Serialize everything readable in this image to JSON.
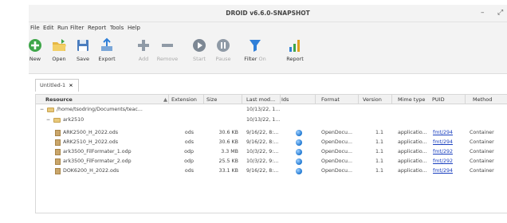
{
  "window": {
    "title": "DROID v6.6.0-SNAPSHOT",
    "minimize": "–",
    "maximize": "⤢"
  },
  "menu": [
    "File",
    "Edit",
    "Run",
    "Filter",
    "Report",
    "Tools",
    "Help"
  ],
  "toolbar": {
    "new": "New",
    "open": "Open",
    "save": "Save",
    "export": "Export",
    "add": "Add",
    "remove": "Remove",
    "start": "Start",
    "pause": "Pause",
    "filter": "Filter",
    "filter_state": "On",
    "report": "Report"
  },
  "tab": {
    "label": "Untitled-1",
    "close": "×"
  },
  "columns": {
    "resource": "Resource",
    "sort": "▲",
    "extension": "Extension",
    "size": "Size",
    "last_modified": "Last mod...",
    "ids": "Ids",
    "format": "Format",
    "version": "Version",
    "mime_type": "Mime type",
    "puid": "PUID",
    "method": "Method"
  },
  "rows": [
    {
      "toggle": "−",
      "name": "/home/tsodring/Documents/teac...",
      "ext": "",
      "size": "",
      "modified": "10/13/22, 1...",
      "format": "",
      "version": "",
      "mime": "",
      "puid": "",
      "method": ""
    },
    {
      "toggle": "−",
      "name": "ark2510",
      "ext": "",
      "size": "",
      "modified": "10/13/22, 1...",
      "format": "",
      "version": "",
      "mime": "",
      "puid": "",
      "method": ""
    },
    {
      "toggle": "",
      "name": "ARK2500_H_2022.ods",
      "ext": "ods",
      "size": "30.6 KB",
      "modified": "9/16/22, 8:...",
      "format": "OpenDocu...",
      "version": "1.1",
      "mime": "applicatio...",
      "puid": "fmt/294",
      "method": "Container"
    },
    {
      "toggle": "",
      "name": "ARK2510_H_2022.ods",
      "ext": "ods",
      "size": "30.6 KB",
      "modified": "9/16/22, 8:...",
      "format": "OpenDocu...",
      "version": "1.1",
      "mime": "applicatio...",
      "puid": "fmt/294",
      "method": "Container"
    },
    {
      "toggle": "",
      "name": "ark3500_FilFormater_1.odp",
      "ext": "odp",
      "size": "3.3 MB",
      "modified": "10/3/22, 9:...",
      "format": "OpenDocu...",
      "version": "1.1",
      "mime": "applicatio...",
      "puid": "fmt/292",
      "method": "Container"
    },
    {
      "toggle": "",
      "name": "ark3500_FilFormater_2.odp",
      "ext": "odp",
      "size": "25.5 KB",
      "modified": "10/3/22, 9:...",
      "format": "OpenDocu...",
      "version": "1.1",
      "mime": "applicatio...",
      "puid": "fmt/292",
      "method": "Container"
    },
    {
      "toggle": "",
      "name": "DOK6200_H_2022.ods",
      "ext": "ods",
      "size": "33.1 KB",
      "modified": "9/16/22, 8:...",
      "format": "OpenDocu...",
      "version": "1.1",
      "mime": "applicatio...",
      "puid": "fmt/294",
      "method": "Container"
    }
  ],
  "colors": {
    "puid_link": "#1a3fbf",
    "toolbar_bg": "#f3f3f3",
    "accent_green": "#3fa64a",
    "accent_blue": "#2f7fd8"
  }
}
